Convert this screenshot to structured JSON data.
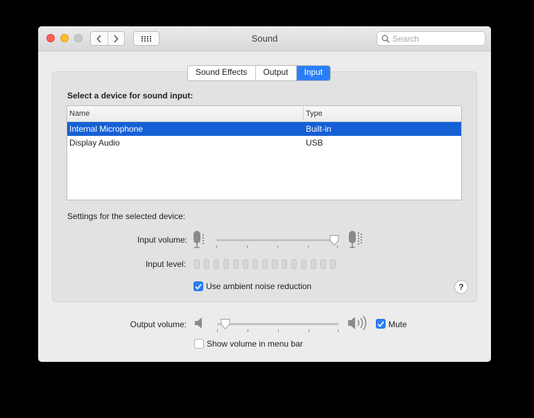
{
  "window": {
    "title": "Sound",
    "search_placeholder": "Search"
  },
  "tabs": [
    {
      "label": "Sound Effects",
      "active": false
    },
    {
      "label": "Output",
      "active": false
    },
    {
      "label": "Input",
      "active": true
    }
  ],
  "input": {
    "section_title": "Select a device for sound input:",
    "columns": {
      "name": "Name",
      "type": "Type"
    },
    "devices": [
      {
        "name": "Internal Microphone",
        "type": "Built-in",
        "selected": true
      },
      {
        "name": "Display Audio",
        "type": "USB",
        "selected": false
      }
    ],
    "settings_label": "Settings for the selected device:",
    "input_volume_label": "Input volume:",
    "input_volume": 0.97,
    "input_level_label": "Input level:",
    "input_level": 0,
    "noise_reduction_label": "Use ambient noise reduction",
    "noise_reduction_checked": true
  },
  "output": {
    "volume_label": "Output volume:",
    "volume": 0.07,
    "mute_label": "Mute",
    "mute_checked": true,
    "menu_bar_label": "Show volume in menu bar",
    "menu_bar_checked": false
  },
  "help_label": "?",
  "colors": {
    "accent": "#2a7ff8",
    "selection": "#1660d5",
    "close": "#fe5f57",
    "minimize": "#febc2e",
    "zoom": "#c8c8c8"
  }
}
